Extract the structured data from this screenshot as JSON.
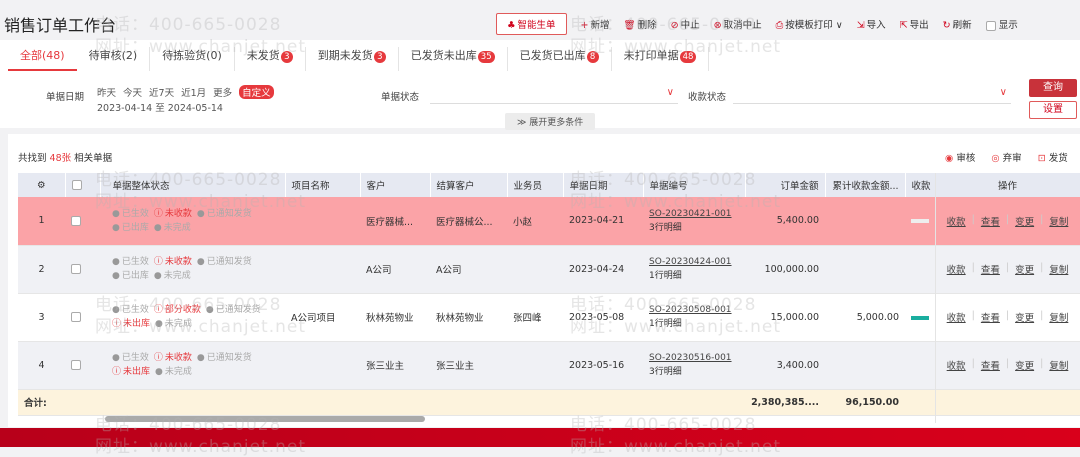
{
  "title": "销售订单工作台",
  "toolbar": {
    "smart": "智能生单",
    "add": "新增",
    "delete": "删除",
    "stop": "中止",
    "cancel_stop": "取消中止",
    "print": "按模板打印",
    "import": "导入",
    "export": "导出",
    "refresh": "刷新",
    "show": "显示"
  },
  "tabs": [
    {
      "label": "全部(48)"
    },
    {
      "label": "待审核(2)"
    },
    {
      "label": "待拣验货(0)"
    },
    {
      "label": "未发货",
      "badge": "3"
    },
    {
      "label": "到期未发货",
      "badge": "3"
    },
    {
      "label": "已发货未出库",
      "badge": "35"
    },
    {
      "label": "已发货已出库",
      "badge": "8"
    },
    {
      "label": "未打印单据",
      "badge": "48"
    }
  ],
  "filters": {
    "date_label": "单据日期",
    "quick": [
      "昨天",
      "今天",
      "近7天",
      "近1月",
      "更多",
      "自定义"
    ],
    "date_range": "2023-04-14 至 2024-05-14",
    "doc_status_label": "单据状态",
    "pay_status_label": "收款状态",
    "query": "查询",
    "settings": "设置",
    "expand": "展开更多条件"
  },
  "summary": {
    "prefix": "共找到",
    "count": "48张",
    "suffix": "相关单据"
  },
  "actions": {
    "audit": "审核",
    "unaudit": "弃审",
    "ship": "发货"
  },
  "columns": [
    "单据整体状态",
    "项目名称",
    "客户",
    "结算客户",
    "业务员",
    "单据日期",
    "单据编号",
    "订单金额",
    "累计收款金额...",
    "收款",
    "操作"
  ],
  "rows": [
    {
      "no": "1",
      "s1": [
        "已生效",
        "未收款",
        "已通知发货"
      ],
      "s2": [
        "已出库",
        "未完成"
      ],
      "project": "",
      "customer": "医疗器械...",
      "settle": "医疗器械公...",
      "sales": "小赵",
      "date": "2023-04-21",
      "code": "SO-20230421-001",
      "detail": "3行明细",
      "amount": "5,400.00",
      "paid": "",
      "bar": "#eeeeee"
    },
    {
      "no": "2",
      "s1": [
        "已生效",
        "未收款",
        "已通知发货"
      ],
      "s2": [
        "已出库",
        "未完成"
      ],
      "project": "",
      "customer": "A公司",
      "settle": "A公司",
      "sales": "",
      "date": "2023-04-24",
      "code": "SO-20230424-001",
      "detail": "1行明细",
      "amount": "100,000.00",
      "paid": "",
      "bar": ""
    },
    {
      "no": "3",
      "s1": [
        "已生效",
        "部分收款",
        "已通知发货"
      ],
      "s2": [
        "未出库",
        "未完成"
      ],
      "project": "A公司项目",
      "customer": "秋林苑物业",
      "settle": "秋林苑物业",
      "sales": "张四峰",
      "date": "2023-05-08",
      "code": "SO-20230508-001",
      "detail": "1行明细",
      "amount": "15,000.00",
      "paid": "5,000.00",
      "bar": "#1aae9f"
    },
    {
      "no": "4",
      "s1": [
        "已生效",
        "未收款",
        "已通知发货"
      ],
      "s2": [
        "未出库",
        "未完成"
      ],
      "project": "",
      "customer": "张三业主",
      "settle": "张三业主",
      "sales": "",
      "date": "2023-05-16",
      "code": "SO-20230516-001",
      "detail": "3行明细",
      "amount": "3,400.00",
      "paid": "",
      "bar": ""
    }
  ],
  "ops": [
    "收款",
    "查看",
    "变更",
    "复制"
  ],
  "total": {
    "label": "合计:",
    "amount": "2,380,385....",
    "paid": "96,150.00"
  },
  "watermark": {
    "phone": "电话：400-665-0028",
    "site": "网址：www.chanjet.net"
  },
  "colors": {
    "accent": "#e6393d",
    "highlight_row": "#fba3a7",
    "footer": "#d9001b"
  }
}
